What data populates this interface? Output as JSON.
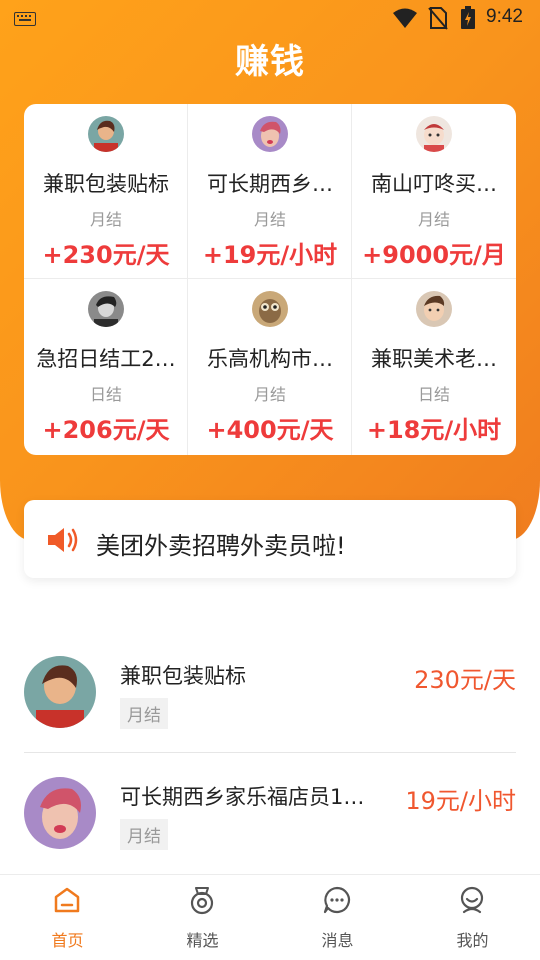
{
  "status_bar": {
    "time": "9:42"
  },
  "header": {
    "title": "赚钱"
  },
  "featured": [
    {
      "title": "兼职包装贴标",
      "pay_cycle": "月结",
      "salary": "+230元/天",
      "avatar": "girl-red-shirt-avatar"
    },
    {
      "title": "可长期西乡…",
      "pay_cycle": "月结",
      "salary": "+19元/小时",
      "avatar": "purple-face-avatar"
    },
    {
      "title": "南山叮咚买…",
      "pay_cycle": "月结",
      "salary": "+9000元/月",
      "avatar": "doll-avatar"
    },
    {
      "title": "急招日结工2…",
      "pay_cycle": "日结",
      "salary": "+206元/天",
      "avatar": "bw-portrait-avatar"
    },
    {
      "title": "乐高机构市…",
      "pay_cycle": "月结",
      "salary": "+400元/天",
      "avatar": "owl-avatar"
    },
    {
      "title": "兼职美术老…",
      "pay_cycle": "日结",
      "salary": "+18元/小时",
      "avatar": "baby-avatar"
    }
  ],
  "notice": {
    "text": "美团外卖招聘外卖员啦!",
    "icon": "speaker-icon"
  },
  "jobs": [
    {
      "title": "兼职包装贴标",
      "tag": "月结",
      "salary": "230元/天"
    },
    {
      "title": "可长期西乡家乐福店员1…",
      "tag": "月结",
      "salary": "19元/小时"
    }
  ],
  "tabs": [
    {
      "label": "首页",
      "icon": "home-icon",
      "active": true
    },
    {
      "label": "精选",
      "icon": "medal-icon",
      "active": false
    },
    {
      "label": "消息",
      "icon": "chat-icon",
      "active": false
    },
    {
      "label": "我的",
      "icon": "profile-icon",
      "active": false
    }
  ],
  "colors": {
    "accent": "#f7941d",
    "salary_red": "#ee3b3b",
    "salary_orange": "#f0572f",
    "active_tab": "#f07a1e"
  }
}
